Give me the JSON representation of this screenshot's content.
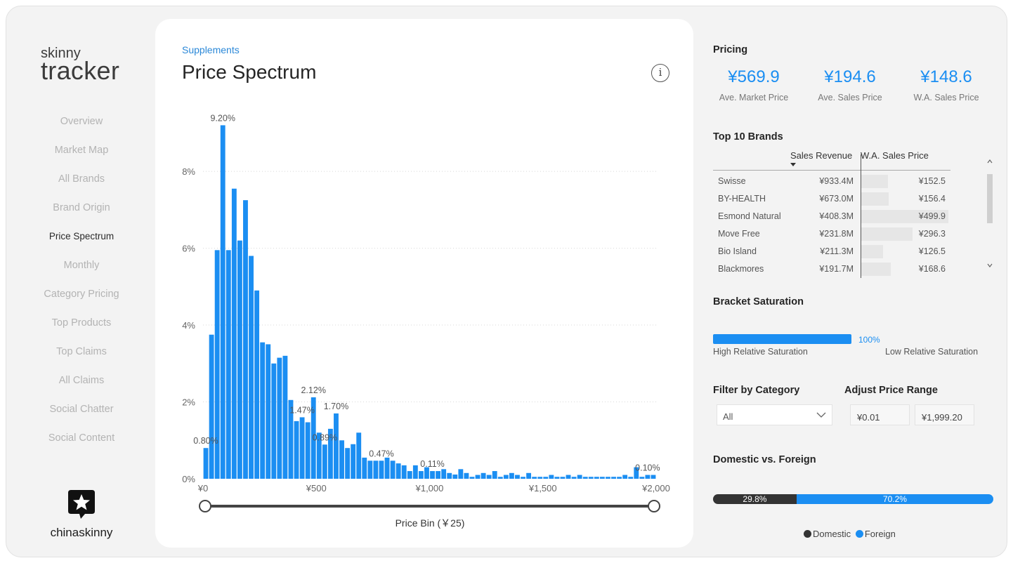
{
  "logo": {
    "line1": "skinny",
    "line2": "tracker"
  },
  "nav": [
    {
      "label": "Overview"
    },
    {
      "label": "Market Map"
    },
    {
      "label": "All Brands"
    },
    {
      "label": "Brand Origin"
    },
    {
      "label": "Price Spectrum",
      "active": true
    },
    {
      "label": "Monthly"
    },
    {
      "label": "Category Pricing"
    },
    {
      "label": "Top Products"
    },
    {
      "label": "Top Claims"
    },
    {
      "label": "All Claims"
    },
    {
      "label": "Social Chatter"
    },
    {
      "label": "Social Content"
    }
  ],
  "brand_name": "chinaskinny",
  "page": {
    "breadcrumb": "Supplements",
    "title": "Price Spectrum",
    "info_glyph": "i"
  },
  "slider": {
    "label": "Price Bin (￥25)",
    "min": 0,
    "max": 2000
  },
  "chart_data": {
    "type": "bar",
    "xlabel": "Price Bin (￥25)",
    "ylabel": "",
    "x_range": [
      0,
      2000
    ],
    "bin_width": 25,
    "ylim": [
      0,
      9.5
    ],
    "y_ticks": [
      "0%",
      "2%",
      "4%",
      "6%",
      "8%"
    ],
    "x_ticks": [
      "¥0",
      "¥500",
      "¥1,000",
      "¥1,500",
      "¥2,000"
    ],
    "grid": true,
    "values": [
      0.8,
      3.75,
      5.95,
      9.2,
      5.95,
      7.55,
      6.2,
      7.25,
      5.8,
      4.9,
      3.55,
      3.5,
      3.0,
      3.15,
      3.2,
      2.05,
      1.5,
      1.6,
      1.47,
      2.12,
      1.2,
      0.89,
      1.3,
      1.7,
      1.0,
      0.8,
      0.9,
      1.2,
      0.55,
      0.47,
      0.47,
      0.47,
      0.55,
      0.47,
      0.4,
      0.35,
      0.2,
      0.35,
      0.2,
      0.3,
      0.2,
      0.2,
      0.25,
      0.15,
      0.11,
      0.25,
      0.15,
      0.05,
      0.1,
      0.15,
      0.1,
      0.2,
      0.05,
      0.1,
      0.15,
      0.1,
      0.05,
      0.15,
      0.05,
      0.05,
      0.05,
      0.1,
      0.05,
      0.05,
      0.1,
      0.05,
      0.1,
      0.05,
      0.05,
      0.05,
      0.05,
      0.05,
      0.05,
      0.05,
      0.1,
      0.05,
      0.3,
      0.05,
      0.1,
      0.1
    ],
    "data_labels": [
      {
        "bin": 0,
        "text": "0.80%"
      },
      {
        "bin": 3,
        "text": "9.20%"
      },
      {
        "bin": 17,
        "text": "1.47%"
      },
      {
        "bin": 19,
        "text": "2.12%"
      },
      {
        "bin": 21,
        "text": "0.89%"
      },
      {
        "bin": 23,
        "text": "1.70%"
      },
      {
        "bin": 31,
        "text": "0.47%"
      },
      {
        "bin": 40,
        "text": "0.11%"
      },
      {
        "bin": 78,
        "text": "0.10%"
      }
    ]
  },
  "pricing": {
    "title": "Pricing",
    "kpis": [
      {
        "value": "¥569.9",
        "label": "Ave. Market Price"
      },
      {
        "value": "¥194.6",
        "label": "Ave. Sales Price"
      },
      {
        "value": "¥148.6",
        "label": "W.A. Sales Price"
      }
    ]
  },
  "top_brands": {
    "title": "Top 10 Brands",
    "col_revenue": "Sales Revenue",
    "col_price": "W.A. Sales Price",
    "max_price": 499.9,
    "rows": [
      {
        "brand": "Swisse",
        "revenue": "¥933.4M",
        "price": "¥152.5",
        "price_value": 152.5
      },
      {
        "brand": "BY-HEALTH",
        "revenue": "¥673.0M",
        "price": "¥156.4",
        "price_value": 156.4
      },
      {
        "brand": "Esmond Natural",
        "revenue": "¥408.3M",
        "price": "¥499.9",
        "price_value": 499.9
      },
      {
        "brand": "Move Free",
        "revenue": "¥231.8M",
        "price": "¥296.3",
        "price_value": 296.3
      },
      {
        "brand": "Bio Island",
        "revenue": "¥211.3M",
        "price": "¥126.5",
        "price_value": 126.5
      },
      {
        "brand": "Blackmores",
        "revenue": "¥191.7M",
        "price": "¥168.6",
        "price_value": 168.6
      }
    ]
  },
  "saturation": {
    "title": "Bracket Saturation",
    "value_label": "100%",
    "value": 1.0,
    "left_label": "High Relative Saturation",
    "right_label": "Low Relative Saturation"
  },
  "filter": {
    "title": "Filter by Category",
    "selected": "All"
  },
  "price_range": {
    "title": "Adjust Price Range",
    "min": "¥0.01",
    "max": "¥1,999.20"
  },
  "domestic_foreign": {
    "title": "Domestic vs. Foreign",
    "domestic": {
      "label": "Domestic",
      "pct": 29.8,
      "text": "29.8%",
      "color": "#333333"
    },
    "foreign": {
      "label": "Foreign",
      "pct": 70.2,
      "text": "70.2%",
      "color": "#1b8ef2"
    }
  },
  "colors": {
    "accent": "#1b8ef2",
    "bar": "#1b8ef2",
    "muted_text": "#b3b3b3"
  }
}
